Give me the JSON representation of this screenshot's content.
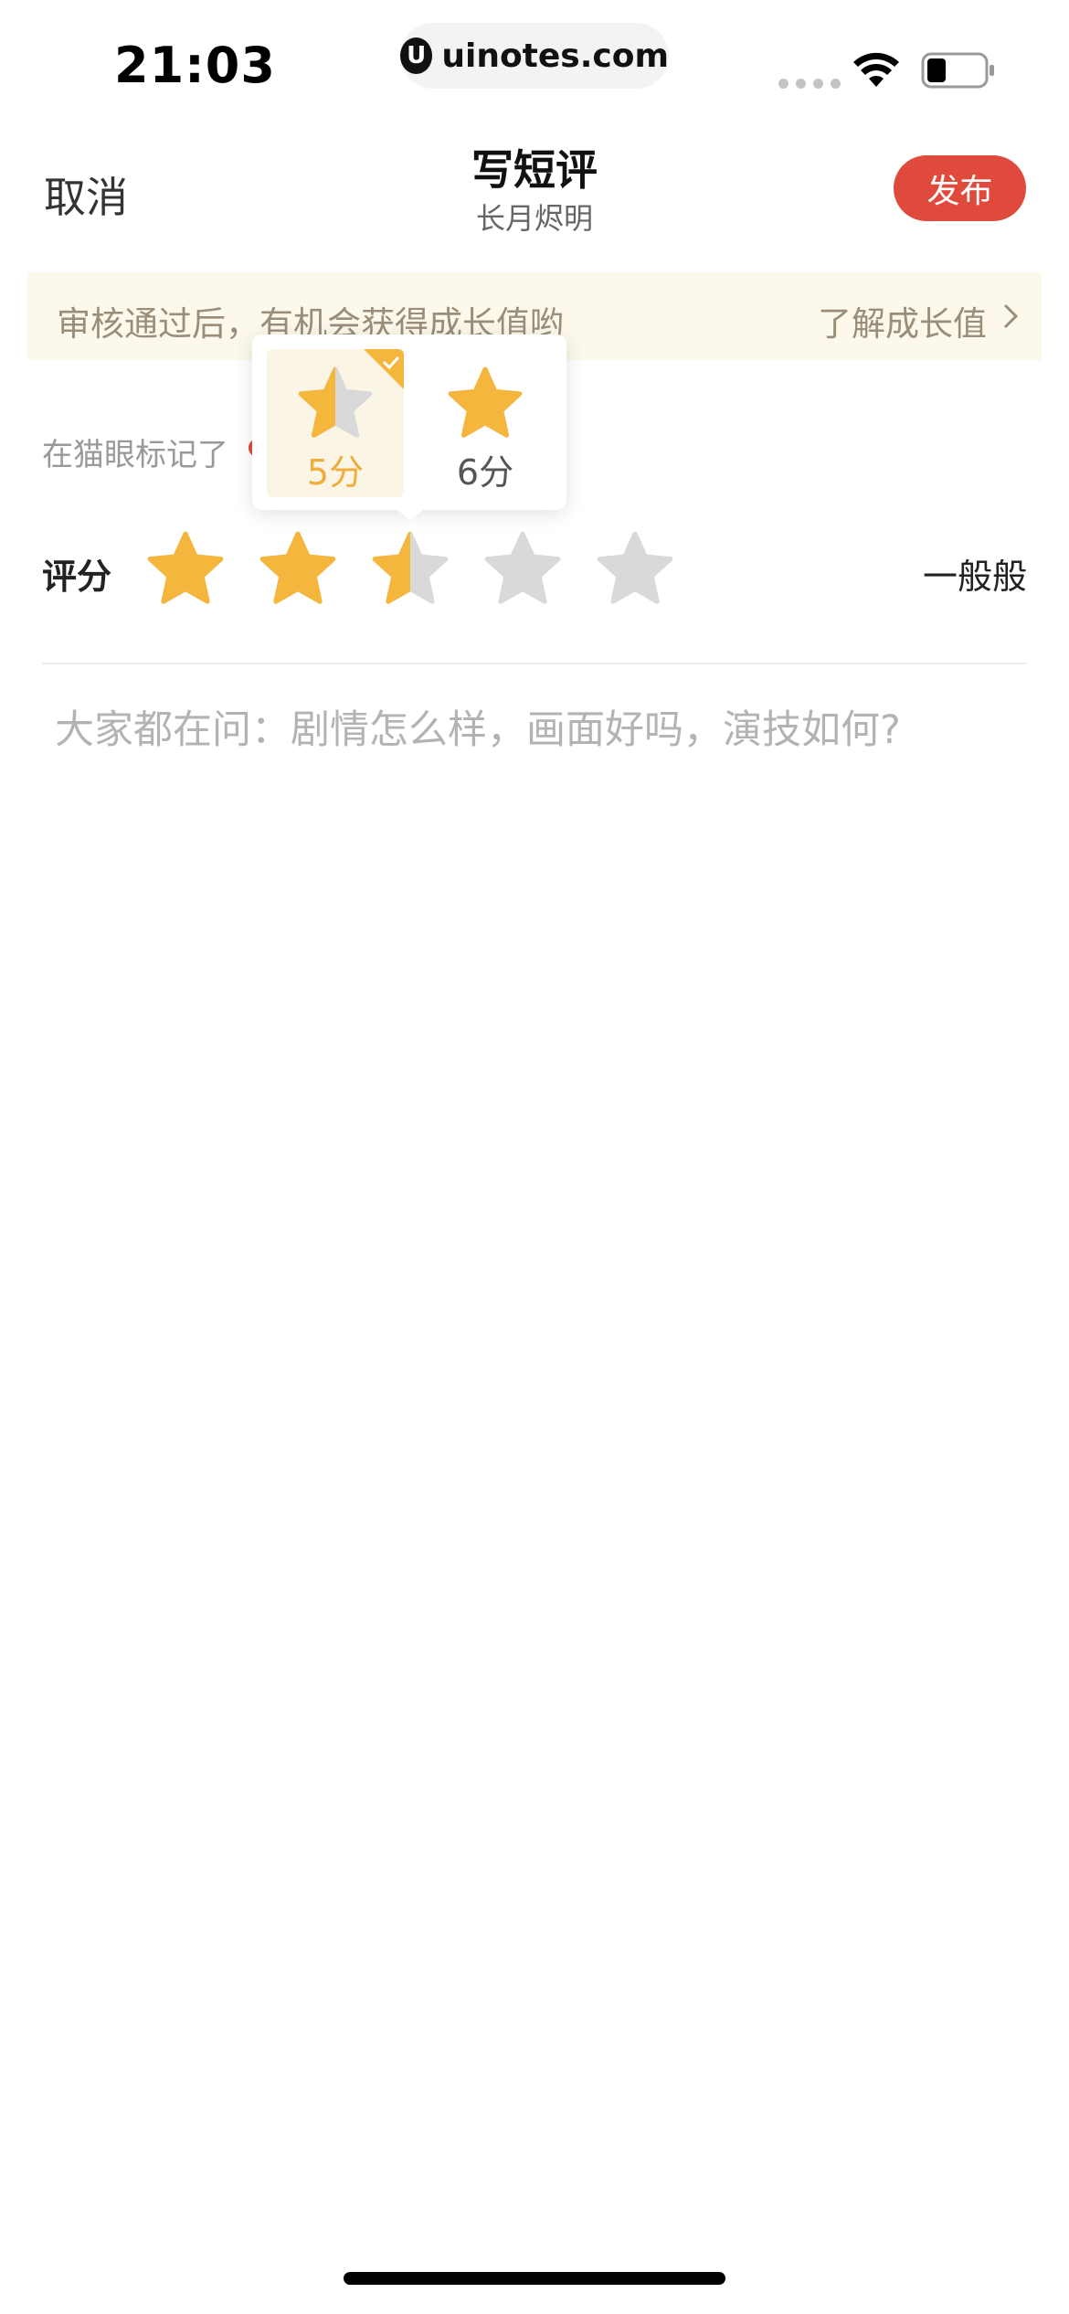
{
  "status_bar": {
    "time": "21:03",
    "url": "uinotes.com"
  },
  "nav": {
    "cancel_label": "取消",
    "title": "写短评",
    "subtitle": "长月烬明",
    "publish_label": "发布"
  },
  "notice": {
    "text": "审核通过后，有机会获得成长值哟",
    "link_label": "了解成长值"
  },
  "marked": {
    "text": "在猫眼标记了"
  },
  "rating": {
    "label": "评分",
    "stars_out_of": 5,
    "current_stars": 2.5,
    "description": "一般般"
  },
  "score_popup": {
    "options": [
      {
        "label": "5分",
        "selected": true,
        "star_fill": 0.5
      },
      {
        "label": "6分",
        "selected": false,
        "star_fill": 1
      }
    ]
  },
  "review": {
    "placeholder": "大家都在问：剧情怎么样，画面好吗，演技如何?"
  },
  "colors": {
    "accent_red": "#e04a3d",
    "star_gold": "#f5b63d",
    "star_gray": "#d9d9d9",
    "banner_bg": "#fdf8ec"
  }
}
